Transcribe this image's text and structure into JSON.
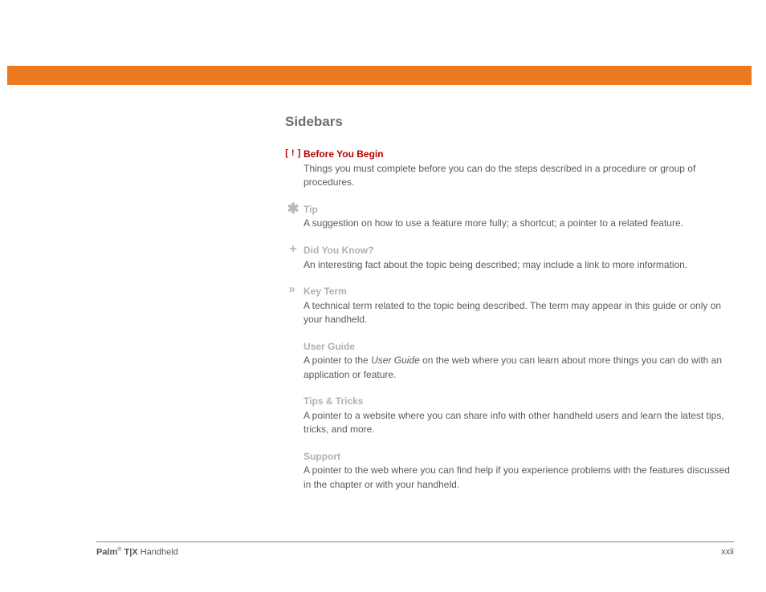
{
  "header": {
    "section_title": "Sidebars"
  },
  "items": {
    "byb": {
      "icon": "[ ! ]",
      "title": "Before You Begin",
      "desc": "Things you must complete before you can do the steps described in a procedure or group of procedures."
    },
    "tip": {
      "icon": "✱",
      "title": "Tip",
      "desc": "A suggestion on how to use a feature more fully; a shortcut; a pointer to a related feature."
    },
    "dyk": {
      "icon": "+",
      "title": "Did You Know?",
      "desc": "An interesting fact about the topic being described; may include a link to more information."
    },
    "kt": {
      "icon": "»",
      "title": "Key Term",
      "desc": "A technical term related to the topic being described. The term may appear in this guide or only on your handheld."
    },
    "ug": {
      "title": "User Guide",
      "desc_pre": "A pointer to the ",
      "desc_italic": "User Guide",
      "desc_post": " on the web where you can learn about more things you can do with an application or feature."
    },
    "tt": {
      "title": "Tips & Tricks",
      "desc": "A pointer to a website where you can share info with other handheld users and learn the latest tips, tricks, and more."
    },
    "sp": {
      "title": "Support",
      "desc": "A pointer to the web where you can find help if you experience problems with the features discussed in the chapter or with your handheld."
    }
  },
  "footer": {
    "brand_bold1": "Palm",
    "brand_sup": "®",
    "brand_bold2": " T|X",
    "brand_rest": " Handheld",
    "page": "xxii"
  }
}
